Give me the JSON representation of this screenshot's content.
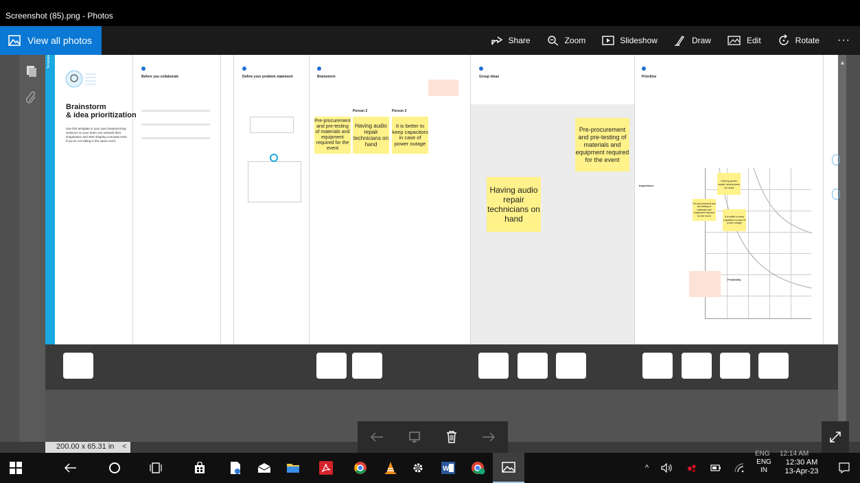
{
  "window": {
    "title": "Screenshot (85).png - Photos"
  },
  "toolbar": {
    "view_all": "View all photos",
    "share": "Share",
    "zoom": "Zoom",
    "slideshow": "Slideshow",
    "draw": "Draw",
    "edit": "Edit",
    "rotate": "Rotate",
    "more": "···"
  },
  "document": {
    "zoom_readout": "200.00 x 65.31 in",
    "template_tag": "Template",
    "brand_title_1": "Brainstorm",
    "brand_title_2": "& idea prioritization",
    "brand_desc": "Use this template in your own brainstorming sessions so your team can unleash their imagination and start shaping concepts even if you're not sitting in the same room.",
    "sections": {
      "collaborate": "Before you collaborate",
      "define": "Define your problem statement",
      "brainstorm": "Brainstorm",
      "group": "Group ideas",
      "prioritize": "Prioritize"
    },
    "person2": "Person 2",
    "person3": "Person 3",
    "sticky_a": "Pre-procurement and pre-testing of materials and equipment required for the event",
    "sticky_b": "Having audio repair technicians on hand",
    "sticky_c": "It is better to keep capacitors in case of power outage",
    "sticky_big_1": "Pre-procurement and pre-testing of materials and equipment required for the event",
    "sticky_big_2": "Having audio repair technicians on hand",
    "grid_note_top": "Having audio repair technicians on hand",
    "grid_note_left": "Pre-procurement and pre-testing of materials and equipment required for the event",
    "grid_note_right": "It is better to keep capacitors in case of power outage",
    "axis_y": "Importance",
    "axis_x": "Feasibility"
  },
  "taskbar": {
    "lang_top": "ENG",
    "lang_bottom": "IN",
    "time": "12:30 AM",
    "date": "13-Apr-23",
    "ghost_lang": "ENG",
    "ghost_time": "12:14 AM"
  }
}
